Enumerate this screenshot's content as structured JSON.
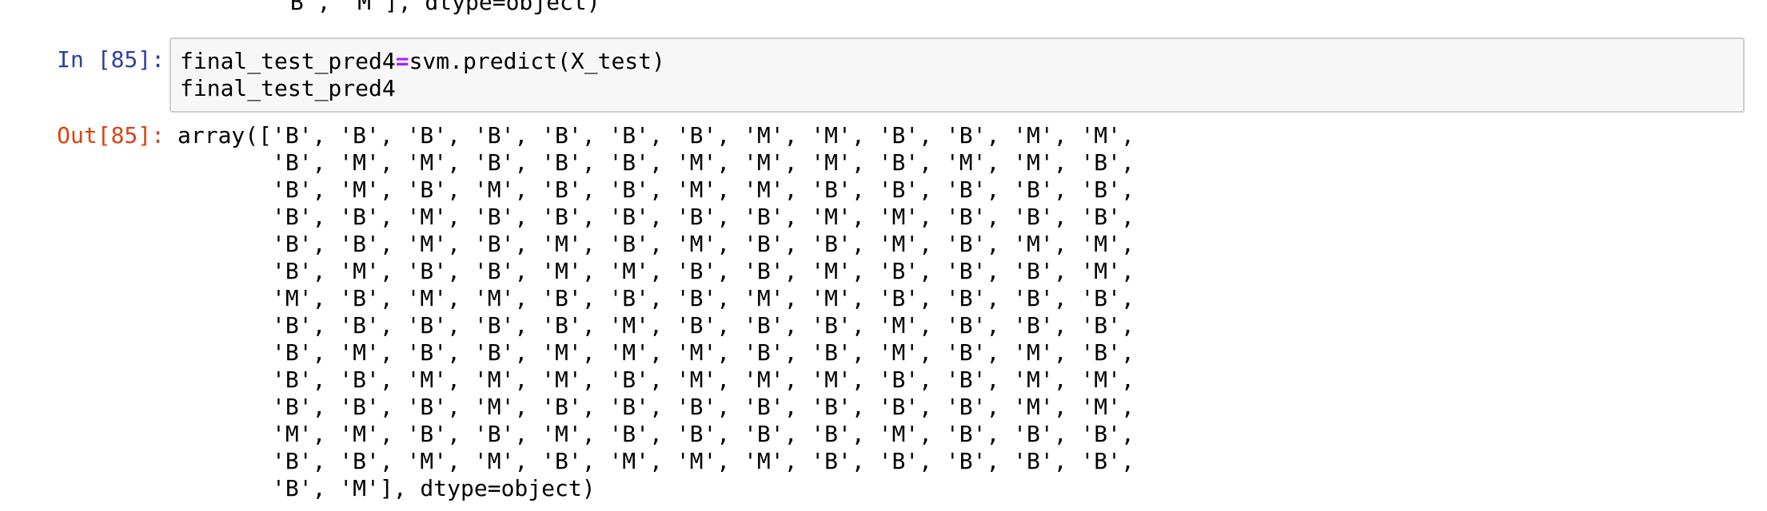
{
  "previous_output_tail": "'B', 'M'], dtype=object)",
  "cell": {
    "in_prompt": "In [85]:",
    "out_prompt": "Out[85]:",
    "code": {
      "line1_var": "final_test_pred4",
      "line1_op": "=",
      "line1_call": "svm.predict(X_test)",
      "line2": "final_test_pred4"
    },
    "output_lines": [
      "array(['B', 'B', 'B', 'B', 'B', 'B', 'B', 'M', 'M', 'B', 'B', 'M', 'M',",
      "       'B', 'M', 'M', 'B', 'B', 'B', 'M', 'M', 'M', 'B', 'M', 'M', 'B',",
      "       'B', 'M', 'B', 'M', 'B', 'B', 'M', 'M', 'B', 'B', 'B', 'B', 'B',",
      "       'B', 'B', 'M', 'B', 'B', 'B', 'B', 'B', 'M', 'M', 'B', 'B', 'B',",
      "       'B', 'B', 'M', 'B', 'M', 'B', 'M', 'B', 'B', 'M', 'B', 'M', 'M',",
      "       'B', 'M', 'B', 'B', 'M', 'M', 'B', 'B', 'M', 'B', 'B', 'B', 'M',",
      "       'M', 'B', 'M', 'M', 'B', 'B', 'B', 'M', 'M', 'B', 'B', 'B', 'B',",
      "       'B', 'B', 'B', 'B', 'B', 'M', 'B', 'B', 'B', 'M', 'B', 'B', 'B',",
      "       'B', 'M', 'B', 'B', 'M', 'M', 'M', 'B', 'B', 'M', 'B', 'M', 'B',",
      "       'B', 'B', 'M', 'M', 'M', 'B', 'M', 'M', 'M', 'B', 'B', 'M', 'M',",
      "       'B', 'B', 'B', 'M', 'B', 'B', 'B', 'B', 'B', 'B', 'B', 'M', 'M',",
      "       'M', 'M', 'B', 'B', 'M', 'B', 'B', 'B', 'B', 'M', 'B', 'B', 'B',",
      "       'B', 'B', 'M', 'M', 'B', 'M', 'M', 'M', 'B', 'B', 'B', 'B', 'B',",
      "       'B', 'M'], dtype=object)"
    ]
  }
}
